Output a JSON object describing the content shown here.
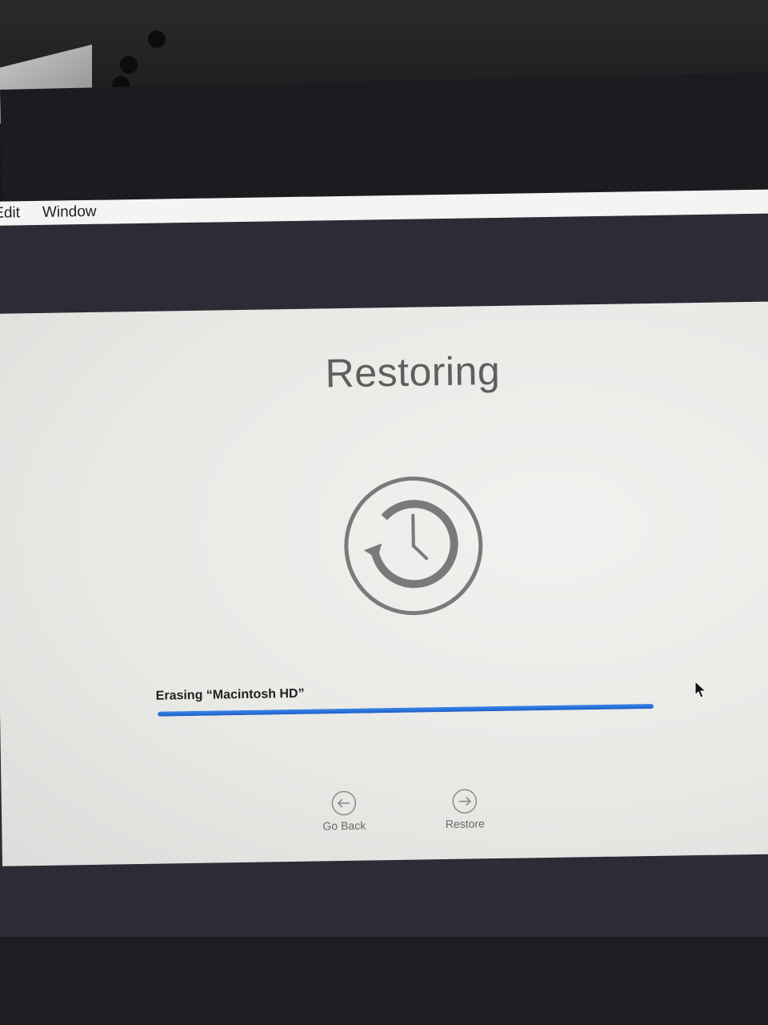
{
  "menubar": {
    "items": [
      "Edit",
      "Window"
    ]
  },
  "window": {
    "title": "Restoring",
    "icon": "time-machine-icon",
    "status_text": "Erasing “Macintosh HD”",
    "progress": 1.0,
    "buttons": {
      "go_back_label": "Go Back",
      "go_back_icon": "arrow-left-circle-icon",
      "restore_label": "Restore",
      "restore_icon": "arrow-right-circle-icon"
    }
  },
  "colors": {
    "progress": "#2a6fd6",
    "icon": "#7a7a7a",
    "title": "#5f5f5f"
  }
}
